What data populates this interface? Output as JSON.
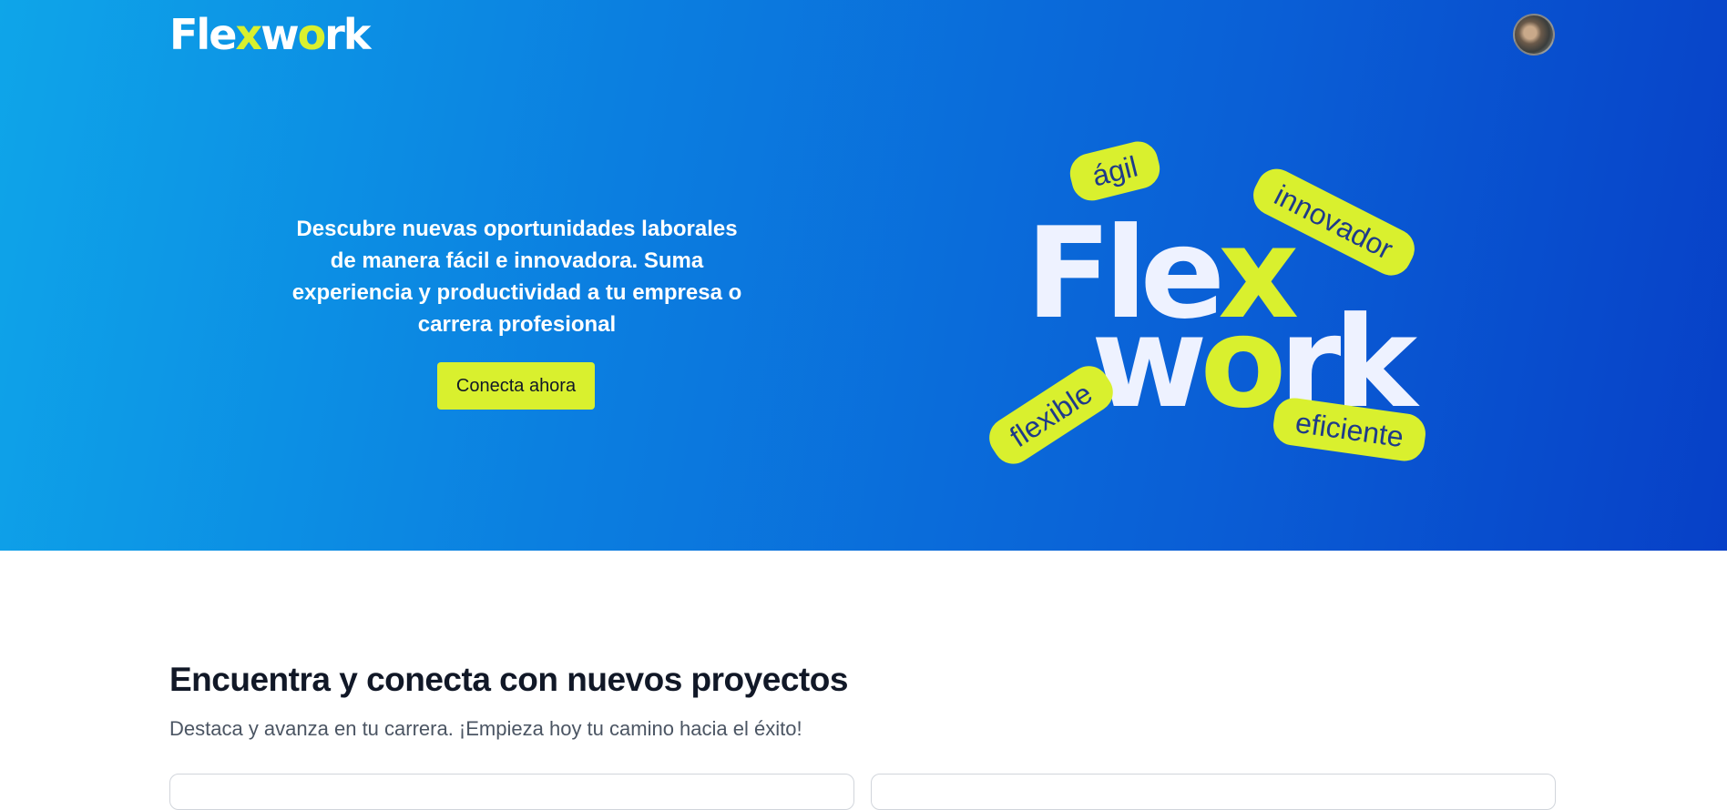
{
  "brand": {
    "logo_part1": "Fle",
    "logo_accent1": "x",
    "logo_part2": "w",
    "logo_accent2": "o",
    "logo_part3": "rk",
    "accent_color": "#d9f02e",
    "hero_gradient": [
      "#0ea5e9",
      "#0740c7"
    ]
  },
  "nav": {
    "avatar_icon": "user-avatar"
  },
  "hero": {
    "headline": "Descubre nuevas oportunidades laborales de manera fácil e innovadora. Suma experiencia y productividad a tu empresa o carrera profesional",
    "cta_label": "Conecta ahora",
    "graphic": {
      "word1_part": "Fle",
      "word1_accent": "x",
      "word2_part1": "w",
      "word2_accent": "o",
      "word2_part2": "rk",
      "tags": [
        "ágil",
        "innovador",
        "flexible",
        "eficiente"
      ]
    }
  },
  "projects": {
    "title": "Encuentra y conecta con nuevos proyectos",
    "subtitle": "Destaca y avanza en tu carrera. ¡Empieza hoy tu camino hacia el éxito!"
  }
}
